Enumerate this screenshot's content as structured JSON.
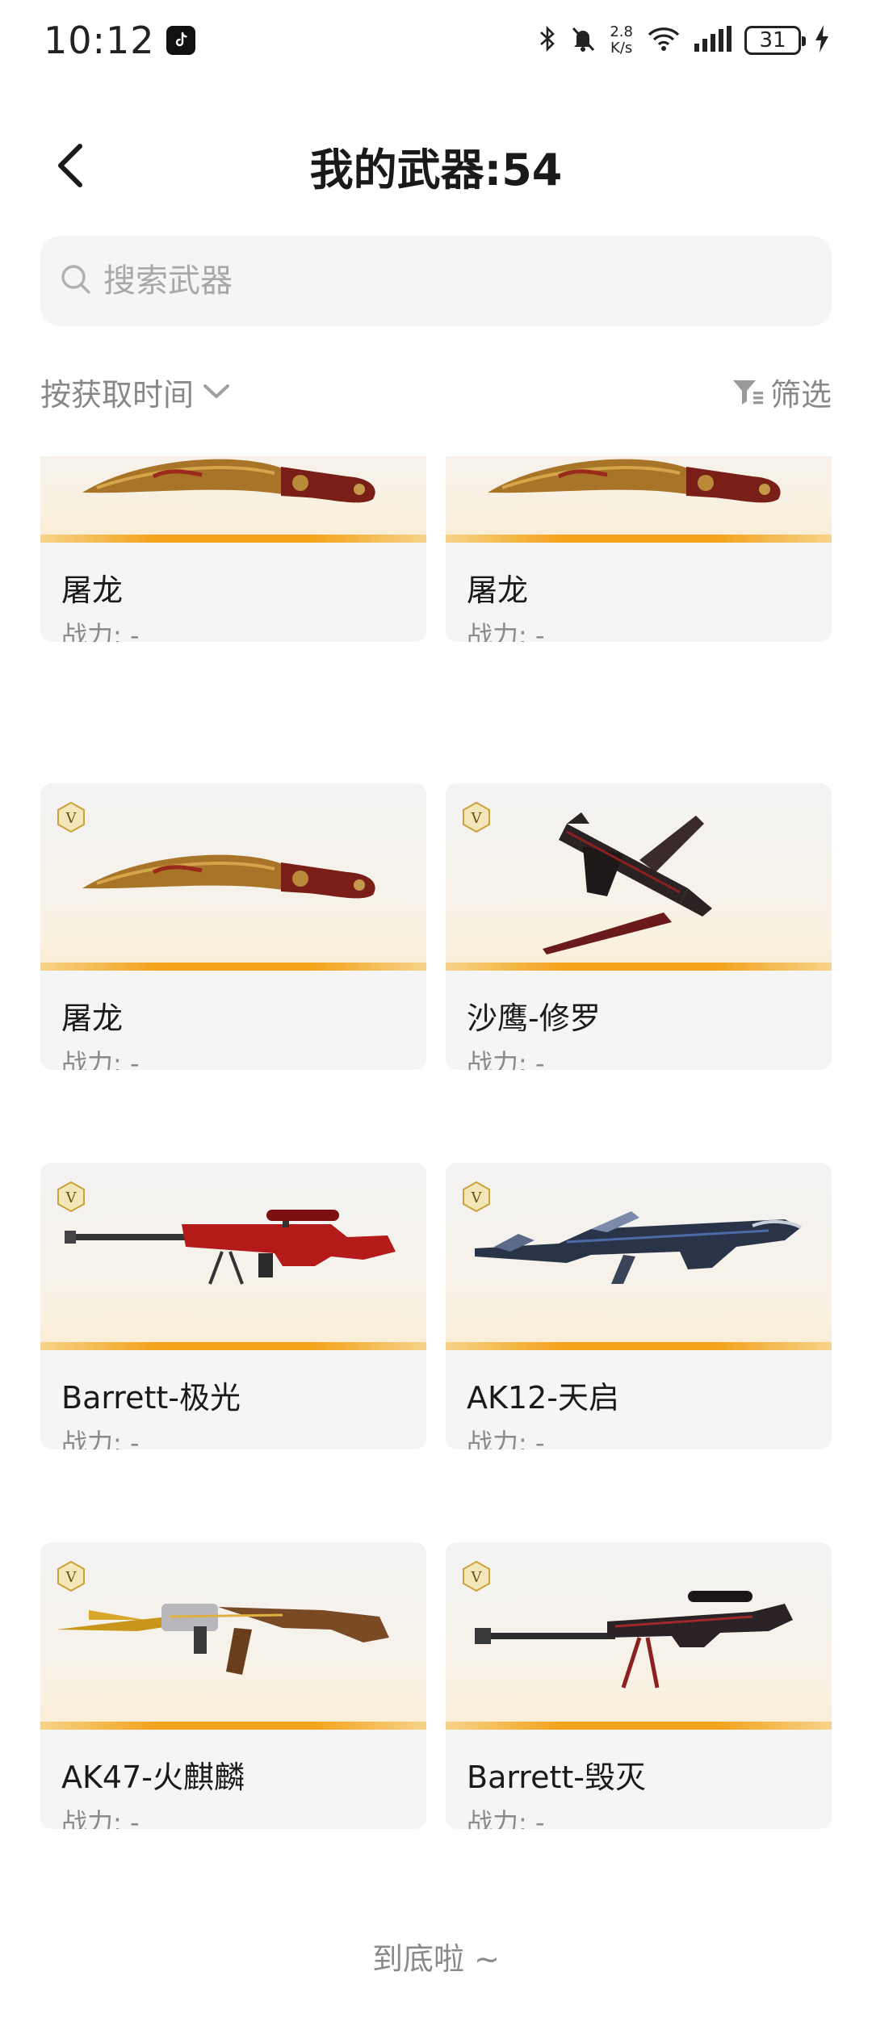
{
  "status_bar": {
    "time": "10:12",
    "net_speed_value": "2.8",
    "net_speed_unit": "K/s",
    "battery": "31"
  },
  "header": {
    "title": "我的武器:54"
  },
  "search": {
    "placeholder": "搜索武器"
  },
  "toolbar": {
    "sort_label": "按获取时间",
    "filter_label": "筛选"
  },
  "colors": {
    "accent_bar": "#f3a21a",
    "card_bg": "#f5f5f5",
    "badge_gold": "#c9a43a"
  },
  "weapons": [
    {
      "name": "屠龙",
      "power": "战力: -",
      "icon": "kukri-knife-icon",
      "badge": false
    },
    {
      "name": "屠龙",
      "power": "战力: -",
      "icon": "kukri-knife-icon",
      "badge": false
    },
    {
      "name": "屠龙",
      "power": "战力: -",
      "icon": "kukri-knife-icon",
      "badge": true
    },
    {
      "name": "沙鹰-修罗",
      "power": "战力: -",
      "icon": "desert-eagle-icon",
      "badge": true
    },
    {
      "name": "Barrett-极光",
      "power": "战力: -",
      "icon": "sniper-rifle-icon",
      "badge": true
    },
    {
      "name": "AK12-天启",
      "power": "战力: -",
      "icon": "assault-rifle-icon",
      "badge": true
    },
    {
      "name": "AK47-火麒麟",
      "power": "战力: -",
      "icon": "ak47-icon",
      "badge": true
    },
    {
      "name": "Barrett-毁灭",
      "power": "战力: -",
      "icon": "sniper-rifle-icon",
      "badge": true
    }
  ],
  "footer": {
    "end_text": "到底啦 ~"
  }
}
